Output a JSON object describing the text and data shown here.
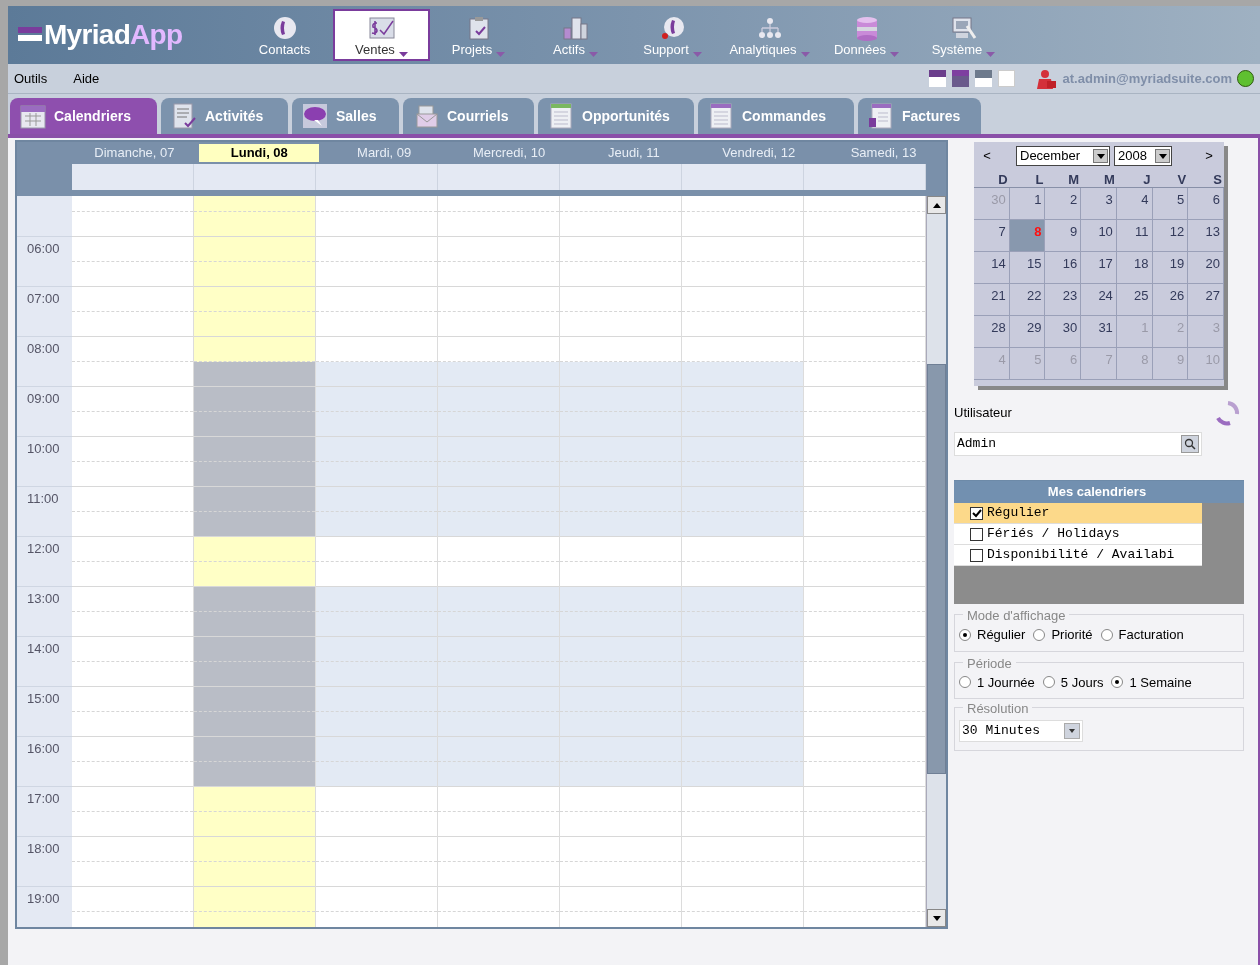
{
  "app": {
    "logo_main": "Myriad",
    "logo_accent": "App"
  },
  "nav": [
    {
      "label": "Contacts",
      "selected": false,
      "menu": false
    },
    {
      "label": "Ventes",
      "selected": true,
      "menu": true
    },
    {
      "label": "Projets",
      "selected": false,
      "menu": true
    },
    {
      "label": "Actifs",
      "selected": false,
      "menu": true
    },
    {
      "label": "Support",
      "selected": false,
      "menu": true
    },
    {
      "label": "Analytiques",
      "selected": false,
      "menu": true
    },
    {
      "label": "Données",
      "selected": false,
      "menu": true
    },
    {
      "label": "Système",
      "selected": false,
      "menu": true
    }
  ],
  "menu_bar": [
    "Outils",
    "Aide"
  ],
  "user": {
    "email": "at.admin@myriadsuite.com",
    "online": true
  },
  "tabs": [
    {
      "label": "Calendriers",
      "selected": true
    },
    {
      "label": "Activités",
      "selected": false
    },
    {
      "label": "Salles",
      "selected": false
    },
    {
      "label": "Courriels",
      "selected": false
    },
    {
      "label": "Opportunités",
      "selected": false
    },
    {
      "label": "Commandes",
      "selected": false
    },
    {
      "label": "Factures",
      "selected": false
    }
  ],
  "week": {
    "days": [
      {
        "label": "Dimanche, 07",
        "selected": false,
        "working": false
      },
      {
        "label": "Lundi, 08",
        "selected": true,
        "working": true
      },
      {
        "label": "Mardi, 09",
        "selected": false,
        "working": true
      },
      {
        "label": "Mercredi, 10",
        "selected": false,
        "working": true
      },
      {
        "label": "Jeudi, 11",
        "selected": false,
        "working": true
      },
      {
        "label": "Vendredi, 12",
        "selected": false,
        "working": true
      },
      {
        "label": "Samedi, 13",
        "selected": false,
        "working": false
      }
    ],
    "hours": [
      {
        "open": [
          false,
          false
        ]
      },
      {
        "label": "06:00",
        "open": [
          false,
          false
        ]
      },
      {
        "label": "07:00",
        "open": [
          false,
          false
        ]
      },
      {
        "label": "08:00",
        "open": [
          false,
          true
        ]
      },
      {
        "label": "09:00",
        "open": [
          true,
          true
        ]
      },
      {
        "label": "10:00",
        "open": [
          true,
          true
        ]
      },
      {
        "label": "11:00",
        "open": [
          true,
          true
        ]
      },
      {
        "label": "12:00",
        "open": [
          false,
          false
        ]
      },
      {
        "label": "13:00",
        "open": [
          true,
          true
        ]
      },
      {
        "label": "14:00",
        "open": [
          true,
          true
        ]
      },
      {
        "label": "15:00",
        "open": [
          true,
          true
        ]
      },
      {
        "label": "16:00",
        "open": [
          true,
          true
        ]
      },
      {
        "label": "17:00",
        "open": [
          false,
          false
        ]
      },
      {
        "label": "18:00",
        "open": [
          false,
          false
        ]
      },
      {
        "label": "19:00",
        "open": [
          false,
          false
        ]
      }
    ]
  },
  "mini_calendar": {
    "prev": "<",
    "next": ">",
    "month": "December",
    "year": "2008",
    "weekdays": [
      "D",
      "L",
      "M",
      "M",
      "J",
      "V",
      "S"
    ],
    "weeks": [
      [
        {
          "label": "30",
          "muted": true,
          "selected": false
        },
        {
          "label": "1",
          "muted": false,
          "selected": false
        },
        {
          "label": "2",
          "muted": false,
          "selected": false
        },
        {
          "label": "3",
          "muted": false,
          "selected": false
        },
        {
          "label": "4",
          "muted": false,
          "selected": false
        },
        {
          "label": "5",
          "muted": false,
          "selected": false
        },
        {
          "label": "6",
          "muted": false,
          "selected": false
        }
      ],
      [
        {
          "label": "7",
          "muted": false,
          "selected": false
        },
        {
          "label": "8",
          "muted": false,
          "selected": true
        },
        {
          "label": "9",
          "muted": false,
          "selected": false
        },
        {
          "label": "10",
          "muted": false,
          "selected": false
        },
        {
          "label": "11",
          "muted": false,
          "selected": false
        },
        {
          "label": "12",
          "muted": false,
          "selected": false
        },
        {
          "label": "13",
          "muted": false,
          "selected": false
        }
      ],
      [
        {
          "label": "14",
          "muted": false,
          "selected": false
        },
        {
          "label": "15",
          "muted": false,
          "selected": false
        },
        {
          "label": "16",
          "muted": false,
          "selected": false
        },
        {
          "label": "17",
          "muted": false,
          "selected": false
        },
        {
          "label": "18",
          "muted": false,
          "selected": false
        },
        {
          "label": "19",
          "muted": false,
          "selected": false
        },
        {
          "label": "20",
          "muted": false,
          "selected": false
        }
      ],
      [
        {
          "label": "21",
          "muted": false,
          "selected": false
        },
        {
          "label": "22",
          "muted": false,
          "selected": false
        },
        {
          "label": "23",
          "muted": false,
          "selected": false
        },
        {
          "label": "24",
          "muted": false,
          "selected": false
        },
        {
          "label": "25",
          "muted": false,
          "selected": false
        },
        {
          "label": "26",
          "muted": false,
          "selected": false
        },
        {
          "label": "27",
          "muted": false,
          "selected": false
        }
      ],
      [
        {
          "label": "28",
          "muted": false,
          "selected": false
        },
        {
          "label": "29",
          "muted": false,
          "selected": false
        },
        {
          "label": "30",
          "muted": false,
          "selected": false
        },
        {
          "label": "31",
          "muted": false,
          "selected": false
        },
        {
          "label": "1",
          "muted": true,
          "selected": false
        },
        {
          "label": "2",
          "muted": true,
          "selected": false
        },
        {
          "label": "3",
          "muted": true,
          "selected": false
        }
      ],
      [
        {
          "label": "4",
          "muted": true,
          "selected": false
        },
        {
          "label": "5",
          "muted": true,
          "selected": false
        },
        {
          "label": "6",
          "muted": true,
          "selected": false
        },
        {
          "label": "7",
          "muted": true,
          "selected": false
        },
        {
          "label": "8",
          "muted": true,
          "selected": false
        },
        {
          "label": "9",
          "muted": true,
          "selected": false
        },
        {
          "label": "10",
          "muted": true,
          "selected": false
        }
      ]
    ]
  },
  "user_filter": {
    "label": "Utilisateur",
    "value": "Admin"
  },
  "calendars": {
    "title": "Mes calendriers",
    "items": [
      {
        "label": "Régulier",
        "checked": true,
        "selected": true
      },
      {
        "label": "Fériés / Holidays",
        "checked": false,
        "selected": false
      },
      {
        "label": "Disponibilité / Availabi",
        "checked": false,
        "selected": false
      }
    ]
  },
  "display_mode": {
    "legend": "Mode d'affichage",
    "options": [
      {
        "label": "Régulier",
        "selected": true
      },
      {
        "label": "Priorité",
        "selected": false
      },
      {
        "label": "Facturation",
        "selected": false
      }
    ]
  },
  "period": {
    "legend": "Période",
    "options": [
      {
        "label": "1 Journée",
        "selected": false
      },
      {
        "label": "5 Jours",
        "selected": false
      },
      {
        "label": "1 Semaine",
        "selected": true
      }
    ]
  },
  "resolution": {
    "legend": "Résolution",
    "value": "30 Minutes"
  }
}
